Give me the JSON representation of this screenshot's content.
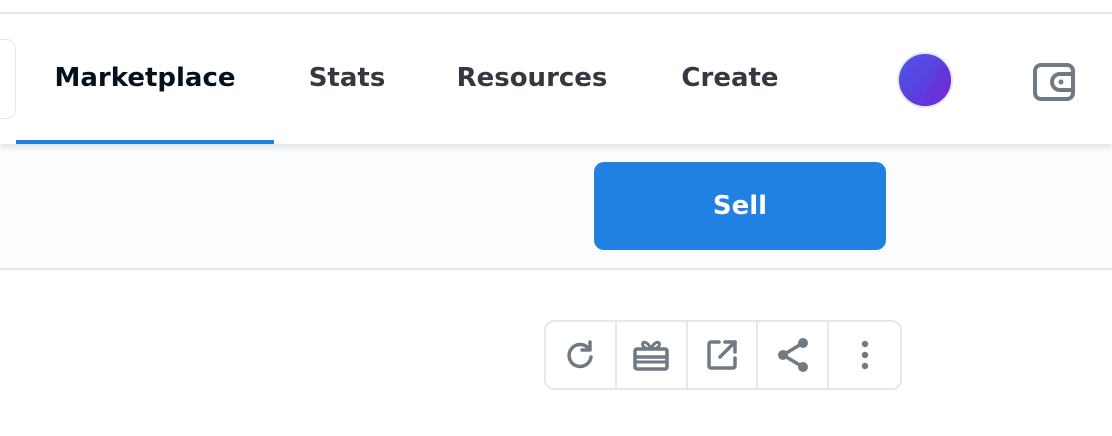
{
  "nav": {
    "tabs": [
      {
        "label": "Marketplace",
        "active": true
      },
      {
        "label": "Stats",
        "active": false
      },
      {
        "label": "Resources",
        "active": false
      },
      {
        "label": "Create",
        "active": false
      }
    ],
    "avatar_icon": "user-avatar",
    "wallet_icon": "wallet-icon"
  },
  "sell": {
    "label": "Sell"
  },
  "toolbar": {
    "buttons": [
      {
        "icon": "refresh-icon"
      },
      {
        "icon": "gift-icon"
      },
      {
        "icon": "external-link-icon"
      },
      {
        "icon": "share-icon"
      },
      {
        "icon": "more-vertical-icon"
      }
    ]
  },
  "colors": {
    "accent": "#2081e2",
    "text_dark": "#04111d",
    "text": "#353840",
    "icon_gray": "#707a83",
    "border": "#e5e8eb"
  }
}
